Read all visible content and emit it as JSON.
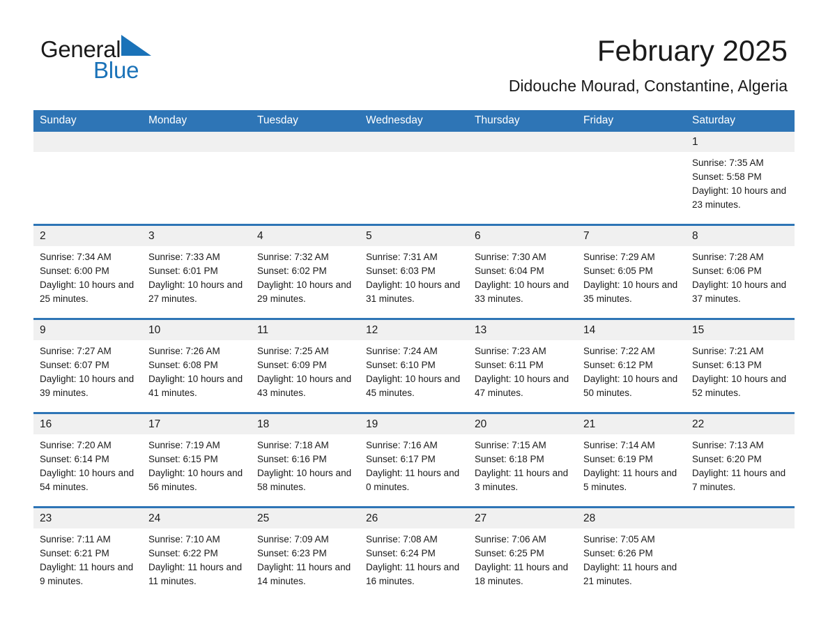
{
  "brand": {
    "name_part1": "General",
    "name_part2": "Blue",
    "triangle_color": "#1a72b8"
  },
  "header": {
    "title": "February 2025",
    "subtitle": "Didouche Mourad, Constantine, Algeria"
  },
  "theme": {
    "header_blue": "#2e75b6",
    "daynum_band": "#f0f0f0",
    "text": "#1a1a1a"
  },
  "weekday_headers": [
    "Sunday",
    "Monday",
    "Tuesday",
    "Wednesday",
    "Thursday",
    "Friday",
    "Saturday"
  ],
  "weeks": [
    [
      {
        "day": "",
        "empty": true
      },
      {
        "day": "",
        "empty": true
      },
      {
        "day": "",
        "empty": true
      },
      {
        "day": "",
        "empty": true
      },
      {
        "day": "",
        "empty": true
      },
      {
        "day": "",
        "empty": true
      },
      {
        "day": "1",
        "sunrise": "Sunrise: 7:35 AM",
        "sunset": "Sunset: 5:58 PM",
        "daylight": "Daylight: 10 hours and 23 minutes."
      }
    ],
    [
      {
        "day": "2",
        "sunrise": "Sunrise: 7:34 AM",
        "sunset": "Sunset: 6:00 PM",
        "daylight": "Daylight: 10 hours and 25 minutes."
      },
      {
        "day": "3",
        "sunrise": "Sunrise: 7:33 AM",
        "sunset": "Sunset: 6:01 PM",
        "daylight": "Daylight: 10 hours and 27 minutes."
      },
      {
        "day": "4",
        "sunrise": "Sunrise: 7:32 AM",
        "sunset": "Sunset: 6:02 PM",
        "daylight": "Daylight: 10 hours and 29 minutes."
      },
      {
        "day": "5",
        "sunrise": "Sunrise: 7:31 AM",
        "sunset": "Sunset: 6:03 PM",
        "daylight": "Daylight: 10 hours and 31 minutes."
      },
      {
        "day": "6",
        "sunrise": "Sunrise: 7:30 AM",
        "sunset": "Sunset: 6:04 PM",
        "daylight": "Daylight: 10 hours and 33 minutes."
      },
      {
        "day": "7",
        "sunrise": "Sunrise: 7:29 AM",
        "sunset": "Sunset: 6:05 PM",
        "daylight": "Daylight: 10 hours and 35 minutes."
      },
      {
        "day": "8",
        "sunrise": "Sunrise: 7:28 AM",
        "sunset": "Sunset: 6:06 PM",
        "daylight": "Daylight: 10 hours and 37 minutes."
      }
    ],
    [
      {
        "day": "9",
        "sunrise": "Sunrise: 7:27 AM",
        "sunset": "Sunset: 6:07 PM",
        "daylight": "Daylight: 10 hours and 39 minutes."
      },
      {
        "day": "10",
        "sunrise": "Sunrise: 7:26 AM",
        "sunset": "Sunset: 6:08 PM",
        "daylight": "Daylight: 10 hours and 41 minutes."
      },
      {
        "day": "11",
        "sunrise": "Sunrise: 7:25 AM",
        "sunset": "Sunset: 6:09 PM",
        "daylight": "Daylight: 10 hours and 43 minutes."
      },
      {
        "day": "12",
        "sunrise": "Sunrise: 7:24 AM",
        "sunset": "Sunset: 6:10 PM",
        "daylight": "Daylight: 10 hours and 45 minutes."
      },
      {
        "day": "13",
        "sunrise": "Sunrise: 7:23 AM",
        "sunset": "Sunset: 6:11 PM",
        "daylight": "Daylight: 10 hours and 47 minutes."
      },
      {
        "day": "14",
        "sunrise": "Sunrise: 7:22 AM",
        "sunset": "Sunset: 6:12 PM",
        "daylight": "Daylight: 10 hours and 50 minutes."
      },
      {
        "day": "15",
        "sunrise": "Sunrise: 7:21 AM",
        "sunset": "Sunset: 6:13 PM",
        "daylight": "Daylight: 10 hours and 52 minutes."
      }
    ],
    [
      {
        "day": "16",
        "sunrise": "Sunrise: 7:20 AM",
        "sunset": "Sunset: 6:14 PM",
        "daylight": "Daylight: 10 hours and 54 minutes."
      },
      {
        "day": "17",
        "sunrise": "Sunrise: 7:19 AM",
        "sunset": "Sunset: 6:15 PM",
        "daylight": "Daylight: 10 hours and 56 minutes."
      },
      {
        "day": "18",
        "sunrise": "Sunrise: 7:18 AM",
        "sunset": "Sunset: 6:16 PM",
        "daylight": "Daylight: 10 hours and 58 minutes."
      },
      {
        "day": "19",
        "sunrise": "Sunrise: 7:16 AM",
        "sunset": "Sunset: 6:17 PM",
        "daylight": "Daylight: 11 hours and 0 minutes."
      },
      {
        "day": "20",
        "sunrise": "Sunrise: 7:15 AM",
        "sunset": "Sunset: 6:18 PM",
        "daylight": "Daylight: 11 hours and 3 minutes."
      },
      {
        "day": "21",
        "sunrise": "Sunrise: 7:14 AM",
        "sunset": "Sunset: 6:19 PM",
        "daylight": "Daylight: 11 hours and 5 minutes."
      },
      {
        "day": "22",
        "sunrise": "Sunrise: 7:13 AM",
        "sunset": "Sunset: 6:20 PM",
        "daylight": "Daylight: 11 hours and 7 minutes."
      }
    ],
    [
      {
        "day": "23",
        "sunrise": "Sunrise: 7:11 AM",
        "sunset": "Sunset: 6:21 PM",
        "daylight": "Daylight: 11 hours and 9 minutes."
      },
      {
        "day": "24",
        "sunrise": "Sunrise: 7:10 AM",
        "sunset": "Sunset: 6:22 PM",
        "daylight": "Daylight: 11 hours and 11 minutes."
      },
      {
        "day": "25",
        "sunrise": "Sunrise: 7:09 AM",
        "sunset": "Sunset: 6:23 PM",
        "daylight": "Daylight: 11 hours and 14 minutes."
      },
      {
        "day": "26",
        "sunrise": "Sunrise: 7:08 AM",
        "sunset": "Sunset: 6:24 PM",
        "daylight": "Daylight: 11 hours and 16 minutes."
      },
      {
        "day": "27",
        "sunrise": "Sunrise: 7:06 AM",
        "sunset": "Sunset: 6:25 PM",
        "daylight": "Daylight: 11 hours and 18 minutes."
      },
      {
        "day": "28",
        "sunrise": "Sunrise: 7:05 AM",
        "sunset": "Sunset: 6:26 PM",
        "daylight": "Daylight: 11 hours and 21 minutes."
      },
      {
        "day": "",
        "empty": true
      }
    ]
  ]
}
